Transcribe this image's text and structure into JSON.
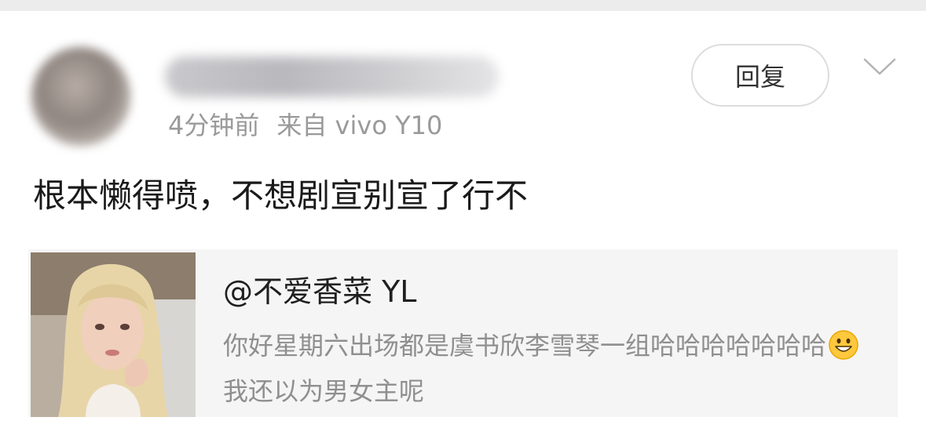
{
  "comment": {
    "time": "4分钟前",
    "source": "来自 vivo Y10",
    "reply_label": "回复",
    "text": "根本懒得喷，不想剧宣别宣了行不"
  },
  "quote": {
    "author": "@不爱香菜 YL",
    "text_part1": "你好星期六出场都是虞书欣李雪琴一组哈哈哈哈哈哈哈",
    "emoji": "grinning-face",
    "text_part2": "我还以为男女主呢"
  },
  "icons": {
    "expand": "chevron-down-icon"
  },
  "colors": {
    "meta_text": "#9a9a9a",
    "quote_background": "#f5f5f5",
    "quote_text": "#8f8f8f",
    "emoji_face": "#ffc83d"
  }
}
